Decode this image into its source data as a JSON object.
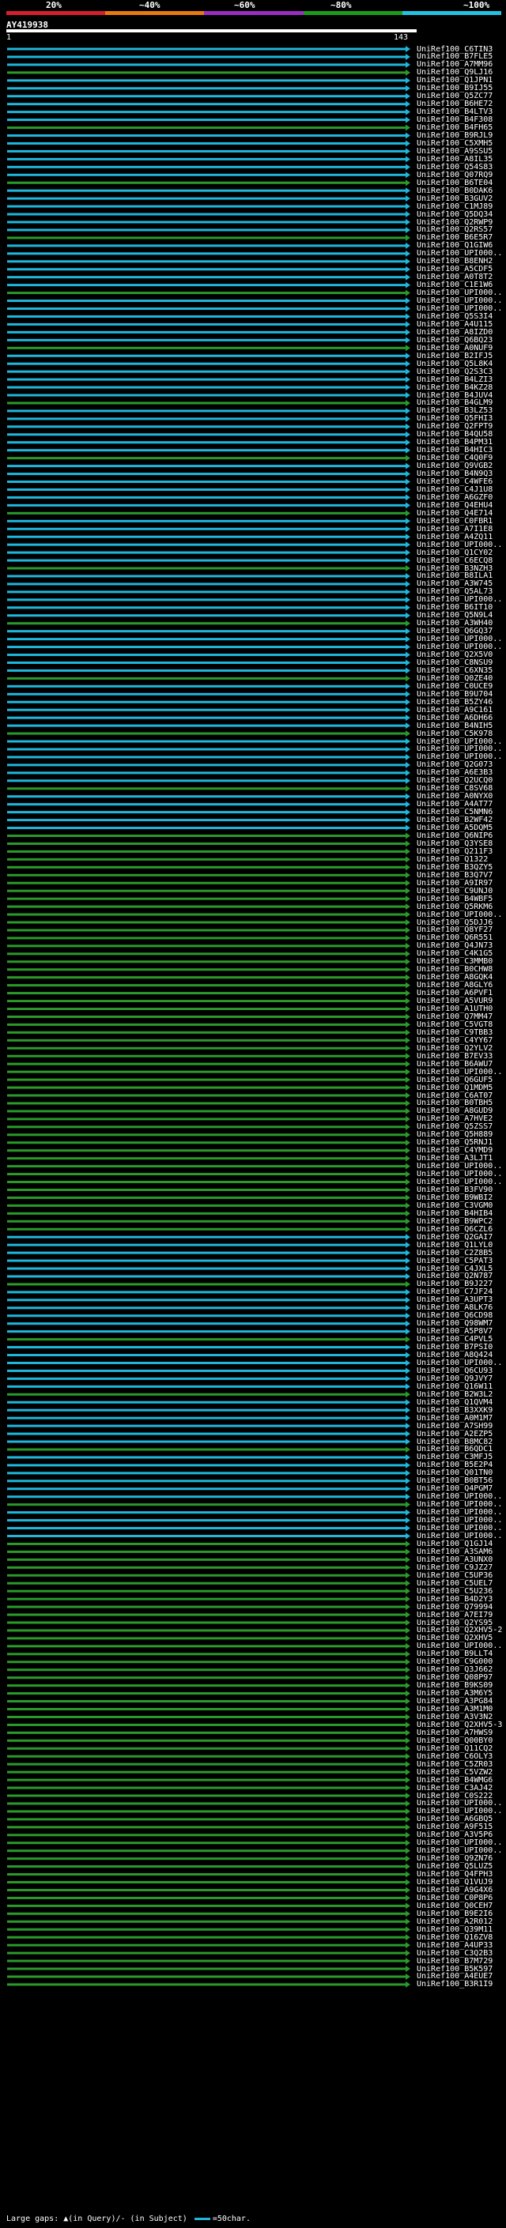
{
  "scale": {
    "labels": [
      "20%",
      "~40%",
      "~60%",
      "~80%",
      "~100%"
    ],
    "colors": [
      "#d81e2e",
      "#e87a10",
      "#9a2ec0",
      "#1c9a1c",
      "#22c2e0"
    ]
  },
  "query": {
    "name": "AY419938",
    "start": "1",
    "end": "143"
  },
  "footer": {
    "text": "Large gaps: ▲(in Query)/- (in Subject)",
    "legend": "=50char."
  },
  "colors": {
    "cyan": "#1fb7dc",
    "green": "#2b9a2b"
  },
  "hits": [
    "UniRef100_C6TIN3",
    "UniRef100_B7FLE5",
    "UniRef100_A7MM96",
    "UniRef100_Q9LJ16",
    "UniRef100_Q1JPN1",
    "UniRef100_B9IJ55",
    "UniRef100_Q5ZC77",
    "UniRef100_B6HE72",
    "UniRef100_B4LTV3",
    "UniRef100_B4F308",
    "UniRef100_B4FH65",
    "UniRef100_B9RJL9",
    "UniRef100_C5XMH5",
    "UniRef100_A9SSU5",
    "UniRef100_A8IL35",
    "UniRef100_Q54S83",
    "UniRef100_Q07RQ9",
    "UniRef100_B6TE04",
    "UniRef100_B0DAK6",
    "UniRef100_B3GUV2",
    "UniRef100_C1MJ89",
    "UniRef100_Q5DQ34",
    "UniRef100_Q2RWP9",
    "UniRef100_Q2RS57",
    "UniRef100_B6E5R7",
    "UniRef100_Q1GIW6",
    "UniRef100_UPI000..",
    "UniRef100_B8ENH2",
    "UniRef100_A5CDF5",
    "UniRef100_A0T8T2",
    "UniRef100_C1E1W6",
    "UniRef100_UPI000..",
    "UniRef100_UPI000..",
    "UniRef100_UPI000..",
    "UniRef100_Q5S3I4",
    "UniRef100_A4U115",
    "UniRef100_A8IZD0",
    "UniRef100_Q6BQ23",
    "UniRef100_A0NUF9",
    "UniRef100_B2IFJ5",
    "UniRef100_Q5L8K4",
    "UniRef100_Q2S3C3",
    "UniRef100_B4LZI3",
    "UniRef100_B4KZ28",
    "UniRef100_B4JUV4",
    "UniRef100_B4GLM9",
    "UniRef100_B3LZ53",
    "UniRef100_Q5FHI3",
    "UniRef100_Q2FPT9",
    "UniRef100_B4QU58",
    "UniRef100_B4PM31",
    "UniRef100_B4HIC3",
    "UniRef100_C4Q0F9",
    "UniRef100_Q9VGB2",
    "UniRef100_B4N9Q3",
    "UniRef100_C4WFE6",
    "UniRef100_C4J1U8",
    "UniRef100_A6GZF0",
    "UniRef100_Q4EHU4",
    "UniRef100_Q4E714",
    "UniRef100_C0FBR1",
    "UniRef100_A7I1E8",
    "UniRef100_A4ZQ11",
    "UniRef100_UPI000..",
    "UniRef100_Q1CY02",
    "UniRef100_C6ECQ8",
    "UniRef100_B3NZH3",
    "UniRef100_B8ILA1",
    "UniRef100_A3W745",
    "UniRef100_Q5AL73",
    "UniRef100_UPI000..",
    "UniRef100_B6IT10",
    "UniRef100_Q5N9L4",
    "UniRef100_A3WH40",
    "UniRef100_Q6GQ37",
    "UniRef100_UPI000..",
    "UniRef100_UPI000..",
    "UniRef100_Q2X5V0",
    "UniRef100_C8NSU9",
    "UniRef100_C6XN35",
    "UniRef100_Q0ZE40",
    "UniRef100_C0UCE9",
    "UniRef100_B9U704",
    "UniRef100_B5ZY46",
    "UniRef100_A9C161",
    "UniRef100_A6DH66",
    "UniRef100_B4NIH5",
    "UniRef100_C5K978",
    "UniRef100_UPI000..",
    "UniRef100_UPI000..",
    "UniRef100_UPI000..",
    "UniRef100_Q2G073",
    "UniRef100_A6E3B3",
    "UniRef100_Q2UCQ0",
    "UniRef100_C8SV68",
    "UniRef100_A0NYX0",
    "UniRef100_A4AT77",
    "UniRef100_C5NMN6",
    "UniRef100_B2WF42",
    "UniRef100_A5DQM5",
    "UniRef100_Q6NIP6",
    "UniRef100_Q3YSE8",
    "UniRef100_Q211F3",
    "UniRef100_Q1322",
    "UniRef100_B3QZY5",
    "UniRef100_B3Q7V7",
    "UniRef100_A9IR97",
    "UniRef100_C9UNJ0",
    "UniRef100_B4WBF5",
    "UniRef100_Q5RKM6",
    "UniRef100_UPI000..",
    "UniRef100_Q5DJJ6",
    "UniRef100_Q8YF27",
    "UniRef100_Q6R551",
    "UniRef100_Q4JN73",
    "UniRef100_C4K1G5",
    "UniRef100_C3MMB0",
    "UniRef100_B0CHW8",
    "UniRef100_A8GQK4",
    "UniRef100_A8GLY6",
    "UniRef100_A6PVF1",
    "UniRef100_A5VUR9",
    "UniRef100_A1UTH0",
    "UniRef100_Q7MM47",
    "UniRef100_C5VGT8",
    "UniRef100_C9TBB3",
    "UniRef100_C4YY67",
    "UniRef100_Q2YLV2",
    "UniRef100_B7EV33",
    "UniRef100_B6AWU7",
    "UniRef100_UPI000..",
    "UniRef100_Q6GUF5",
    "UniRef100_Q1MDM5",
    "UniRef100_C6AT07",
    "UniRef100_B0TBH5",
    "UniRef100_A8GUD9",
    "UniRef100_A7HVE2",
    "UniRef100_Q5ZSS7",
    "UniRef100_Q5H889",
    "UniRef100_Q5RNJ1",
    "UniRef100_C4YMD9",
    "UniRef100_A3LJT1",
    "UniRef100_UPI000..",
    "UniRef100_UPI000..",
    "UniRef100_UPI000..",
    "UniRef100_B3FV90",
    "UniRef100_B9WBI2",
    "UniRef100_C3VGM0",
    "UniRef100_B4HIB4",
    "UniRef100_B9WPC2",
    "UniRef100_Q6CZL6",
    "UniRef100_Q2GAI7",
    "UniRef100_Q1LYL0",
    "UniRef100_C2Z8B5",
    "UniRef100_C5PAT3",
    "UniRef100_C4JXL5",
    "UniRef100_Q2N787",
    "UniRef100_B9J227",
    "UniRef100_C7JF24",
    "UniRef100_A3UPT3",
    "UniRef100_A8LK76",
    "UniRef100_Q6CD98",
    "UniRef100_Q98WM7",
    "UniRef100_A5P8V7",
    "UniRef100_C4PVL5",
    "UniRef100_B7PSI0",
    "UniRef100_A8Q424",
    "UniRef100_UPI000..",
    "UniRef100_Q6CU93",
    "UniRef100_Q9JVY7",
    "UniRef100_Q16W11",
    "UniRef100_B2W3L2",
    "UniRef100_Q1QVM4",
    "UniRef100_B3XXK9",
    "UniRef100_A0M1M7",
    "UniRef100_A7SH99",
    "UniRef100_A2EZP5",
    "UniRef100_B8MC82",
    "UniRef100_B6QDC1",
    "UniRef100_C3MFJ5",
    "UniRef100_B5E2P4",
    "UniRef100_Q01TN0",
    "UniRef100_B0BT56",
    "UniRef100_Q4PGM7",
    "UniRef100_UPI000..",
    "UniRef100_UPI000..",
    "UniRef100_UPI000..",
    "UniRef100_UPI000..",
    "UniRef100_UPI000..",
    "UniRef100_UPI000..",
    "UniRef100_Q1GJ14",
    "UniRef100_A3SAM6",
    "UniRef100_A3UNX0",
    "UniRef100_C9JZ27",
    "UniRef100_C5UP36",
    "UniRef100_C5UEL7",
    "UniRef100_C5U236",
    "UniRef100_B4D2Y3",
    "UniRef100_Q79994",
    "UniRef100_A7EI79",
    "UniRef100_Q2YS95",
    "UniRef100_Q2XHV5-2",
    "UniRef100_Q2XHV5",
    "UniRef100_UPI000..",
    "UniRef100_B9LLT4",
    "UniRef100_C9G000",
    "UniRef100_Q3J662",
    "UniRef100_Q08P97",
    "UniRef100_B9KS09",
    "UniRef100_A3M6Y5",
    "UniRef100_A3PG84",
    "UniRef100_A3M1M0",
    "UniRef100_A3V3N2",
    "UniRef100_Q2XHV5-3",
    "UniRef100_A7HWS9",
    "UniRef100_Q00BY0",
    "UniRef100_Q11CQ2",
    "UniRef100_C6OLY3",
    "UniRef100_C5ZR03",
    "UniRef100_C5VZW2",
    "UniRef100_B4WMG6",
    "UniRef100_C3AJ42",
    "UniRef100_C0S222",
    "UniRef100_UPI000..",
    "UniRef100_UPI000..",
    "UniRef100_A6GBQ5",
    "UniRef100_A9F515",
    "UniRef100_A3V5P6",
    "UniRef100_UPI000..",
    "UniRef100_UPI000..",
    "UniRef100_Q9ZN76",
    "UniRef100_Q5LUZ5",
    "UniRef100_Q4FPH3",
    "UniRef100_Q1VUJ9",
    "UniRef100_A9G4X6",
    "UniRef100_C0P8P6",
    "UniRef100_Q0CEH7",
    "UniRef100_B9E2I6",
    "UniRef100_A2R012",
    "UniRef100_Q39M11",
    "UniRef100_Q16ZV8",
    "UniRef100_A4UP33",
    "UniRef100_C3Q2B3",
    "UniRef100_B7M729",
    "UniRef100_B5K597",
    "UniRef100_A4EUE7",
    "UniRef100_B3R1I9"
  ]
}
